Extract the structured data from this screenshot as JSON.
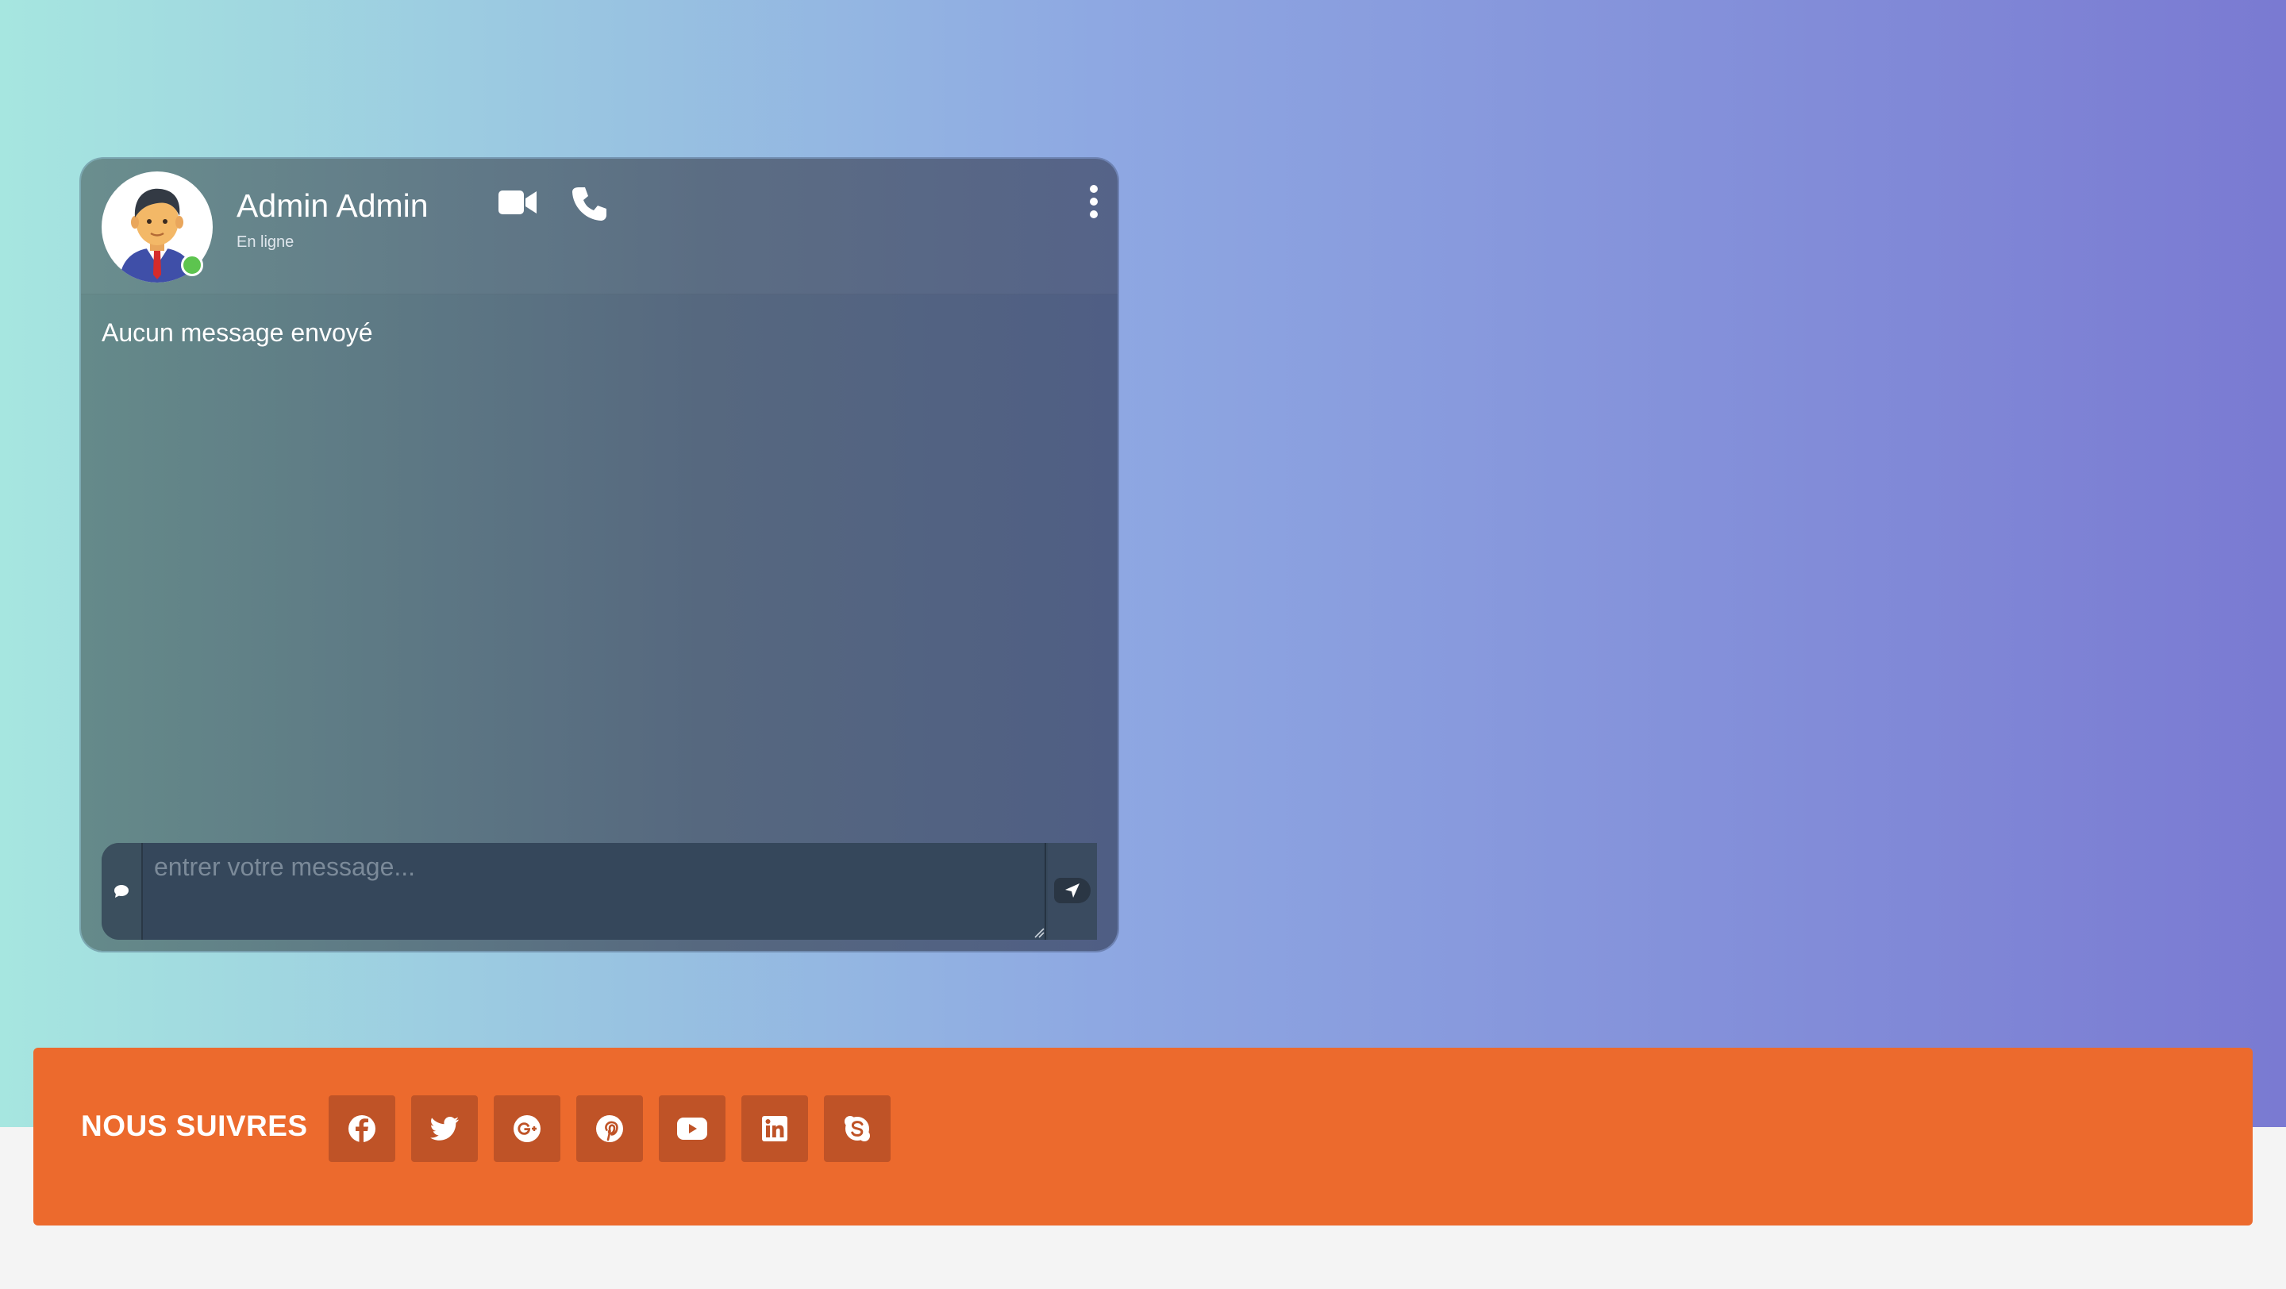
{
  "chat": {
    "contact_name": "Admin Admin",
    "contact_status": "En ligne",
    "empty_message": "Aucun message envoyé",
    "input_placeholder": "entrer votre message...",
    "online_color": "#5dc44f",
    "icons": {
      "video": "video-camera-icon",
      "phone": "phone-icon",
      "menu": "vertical-ellipsis-icon",
      "composer": "chat-bubble-icon",
      "send": "paper-plane-icon"
    }
  },
  "footer": {
    "follow_label": "NOUS SUIVRES",
    "accent_color": "#ec6a2d",
    "social_links": [
      {
        "name": "facebook",
        "icon": "facebook-icon"
      },
      {
        "name": "twitter",
        "icon": "twitter-icon"
      },
      {
        "name": "google-plus",
        "icon": "google-plus-icon"
      },
      {
        "name": "pinterest",
        "icon": "pinterest-icon"
      },
      {
        "name": "youtube",
        "icon": "youtube-icon"
      },
      {
        "name": "linkedin",
        "icon": "linkedin-icon"
      },
      {
        "name": "skype",
        "icon": "skype-icon"
      }
    ]
  }
}
